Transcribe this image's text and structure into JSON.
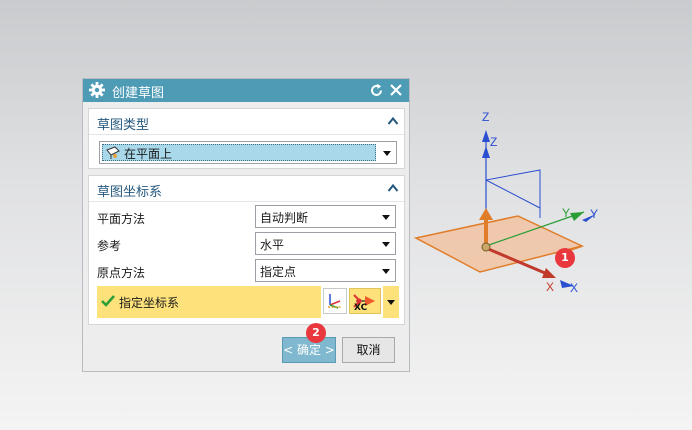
{
  "dialog": {
    "title": "创建草图",
    "title_icon": "gear-icon",
    "reset_icon": "reset-icon",
    "close_icon": "close-icon",
    "sketch_type": {
      "heading": "草图类型",
      "selected": "在平面上"
    },
    "sketch_csys": {
      "heading": "草图坐标系",
      "rows": [
        {
          "label": "平面方法",
          "value": "自动判断"
        },
        {
          "label": "参考",
          "value": "水平"
        },
        {
          "label": "原点方法",
          "value": "指定点"
        }
      ],
      "specify": "指定坐标系",
      "xc_label": "XC"
    },
    "ok_label": "< 确定 >",
    "cancel_label": "取消"
  },
  "badges": {
    "one": "1",
    "two": "2"
  },
  "axes": {
    "z1": "Z",
    "z2": "Z",
    "y1": "Y",
    "y2": "Y",
    "x1": "X",
    "x2": "X"
  },
  "colors": {
    "title_bar": "#4e9bb5",
    "heading": "#24587e",
    "highlight": "#fde17a",
    "badge": "#e8383d",
    "plane": "#e07d2a"
  }
}
